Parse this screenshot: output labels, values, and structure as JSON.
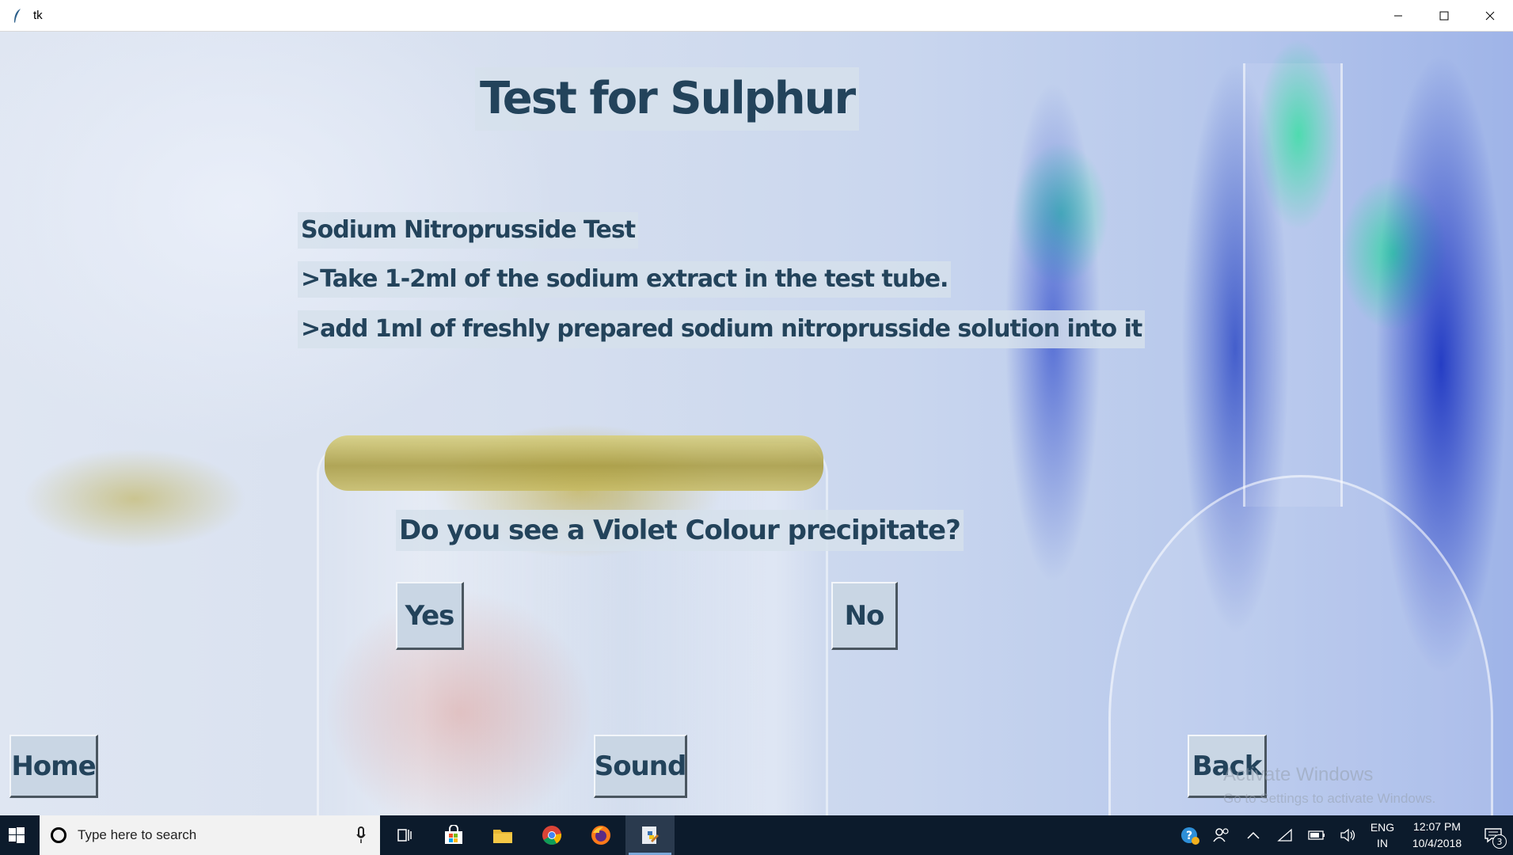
{
  "window": {
    "title": "tk",
    "icon": "feather-icon",
    "controls": [
      "minimize-icon",
      "maximize-icon",
      "close-icon"
    ]
  },
  "app": {
    "title": "Test for Sulphur",
    "subtitle": "Sodium Nitroprusside Test",
    "steps": [
      ">Take 1-2ml of the sodium extract in the test tube.",
      ">add 1ml of freshly prepared sodium nitroprusside solution into it"
    ],
    "question": "Do you see a Violet Colour precipitate?",
    "buttons": {
      "yes": "Yes",
      "no": "No",
      "home": "Home",
      "sound": "Sound",
      "back": "Back"
    },
    "text_color": "#23435b",
    "label_bg": "#d6e0ec"
  },
  "watermark": {
    "line1": "Activate Windows",
    "line2": "Go to Settings to activate Windows."
  },
  "taskbar": {
    "search_placeholder": "Type here to search",
    "apps": [
      "task-view-icon",
      "store-icon",
      "file-explorer-icon",
      "chrome-icon",
      "firefox-icon",
      "python-idle-icon"
    ],
    "language": {
      "line1": "ENG",
      "line2": "IN"
    },
    "clock": {
      "time": "12:07 PM",
      "date": "10/4/2018"
    },
    "notification_count": "3",
    "color": "#0c1b2c"
  }
}
